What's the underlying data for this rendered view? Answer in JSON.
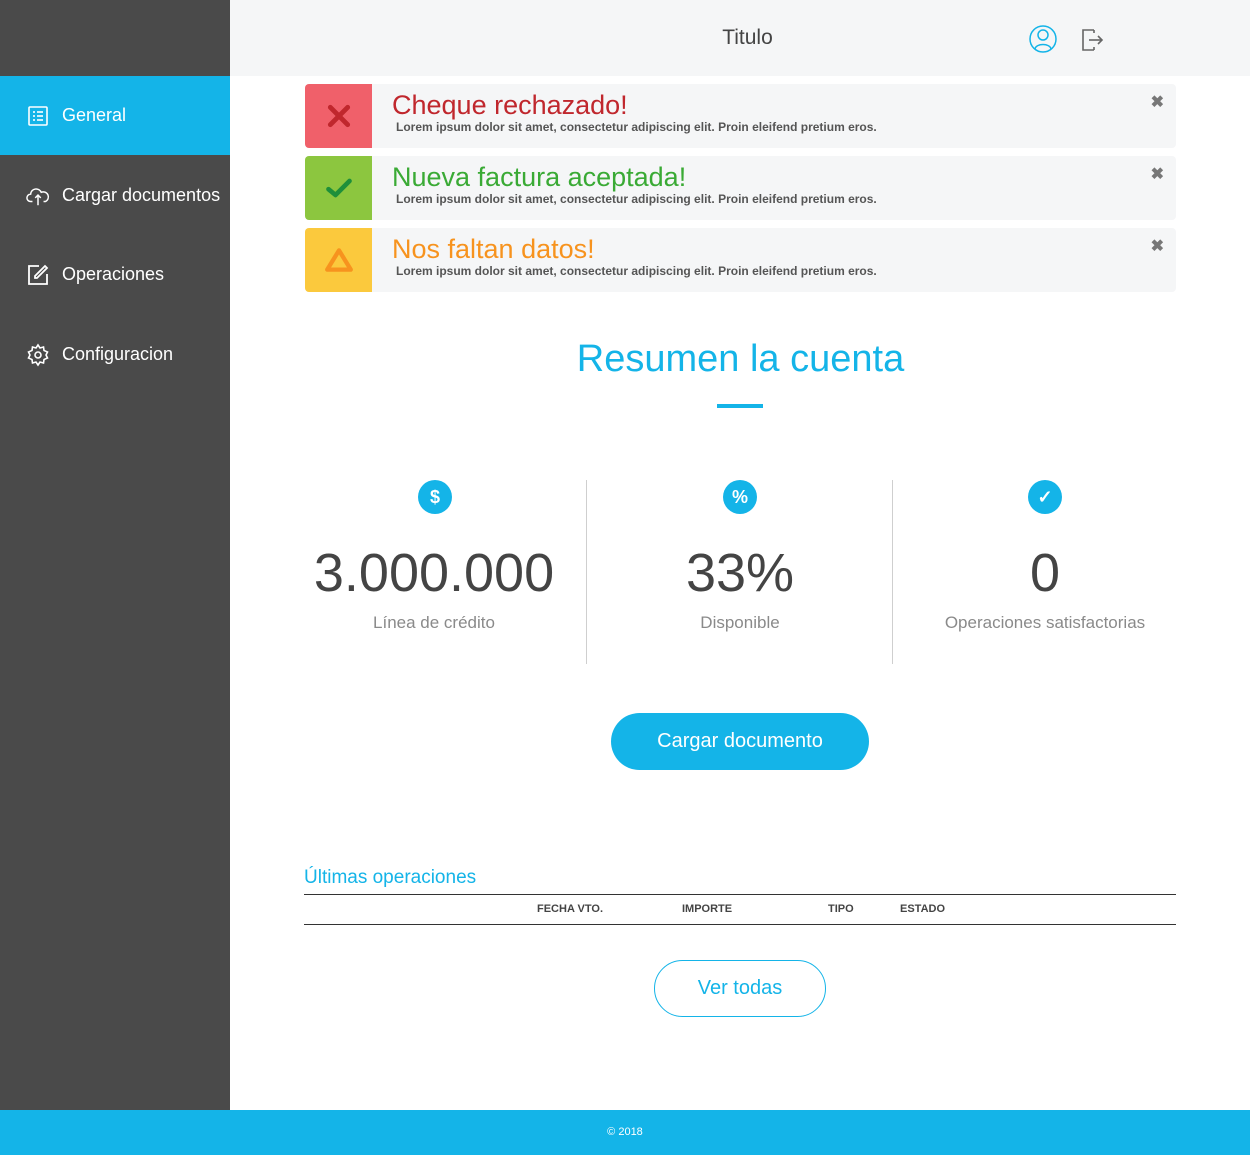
{
  "header": {
    "title": "Titulo",
    "user_icon": "user-icon",
    "logout_icon": "logout-icon"
  },
  "sidebar": {
    "items": [
      {
        "label": "General",
        "icon": "list-icon",
        "active": true
      },
      {
        "label": "Cargar documentos",
        "icon": "cloud-upload-icon",
        "active": false
      },
      {
        "label": "Operaciones",
        "icon": "edit-icon",
        "active": false
      },
      {
        "label": "Configuracion",
        "icon": "gear-icon",
        "active": false
      }
    ]
  },
  "alerts": [
    {
      "title": "Cheque rechazado!",
      "text": "Lorem ipsum dolor sit amet, consectetur adipiscing elit. Proin eleifend pretium eros.",
      "color": "#c0272d",
      "badge_color": "#f0606a",
      "icon": "x-icon",
      "close": "✖"
    },
    {
      "title": "Nueva factura aceptada!",
      "text": "Lorem ipsum dolor sit amet, consectetur adipiscing elit. Proin eleifend pretium eros.",
      "color": "#3aaa35",
      "badge_color": "#8cc63f",
      "icon": "check-icon",
      "close": "✖"
    },
    {
      "title": "Nos faltan datos!",
      "text": "Lorem ipsum dolor sit amet, consectetur adipiscing elit. Proin eleifend pretium eros.",
      "color": "#f7931e",
      "badge_color": "#fbc93d",
      "icon": "warning-icon",
      "close": "✖"
    }
  ],
  "summary": {
    "title": "Resumen la cuenta",
    "stats": [
      {
        "icon": "$",
        "icon_name": "dollar-icon",
        "value": "3.000.000",
        "label": "Línea de crédito"
      },
      {
        "icon": "%",
        "icon_name": "percent-icon",
        "value": "33%",
        "label": "Disponible"
      },
      {
        "icon": "✓",
        "icon_name": "check-circle-icon",
        "value": "0",
        "label": "Operaciones satisfactorias"
      }
    ],
    "upload_button": "Cargar documento"
  },
  "operations": {
    "title": "Últimas operaciones",
    "columns": [
      "FECHA VTO.",
      "IMPORTE",
      "TIPO",
      "ESTADO"
    ],
    "view_all": "Ver todas"
  },
  "footer": {
    "text": "© 2018"
  },
  "colors": {
    "accent": "#14b4e8",
    "sidebar": "#4a4a4a"
  }
}
